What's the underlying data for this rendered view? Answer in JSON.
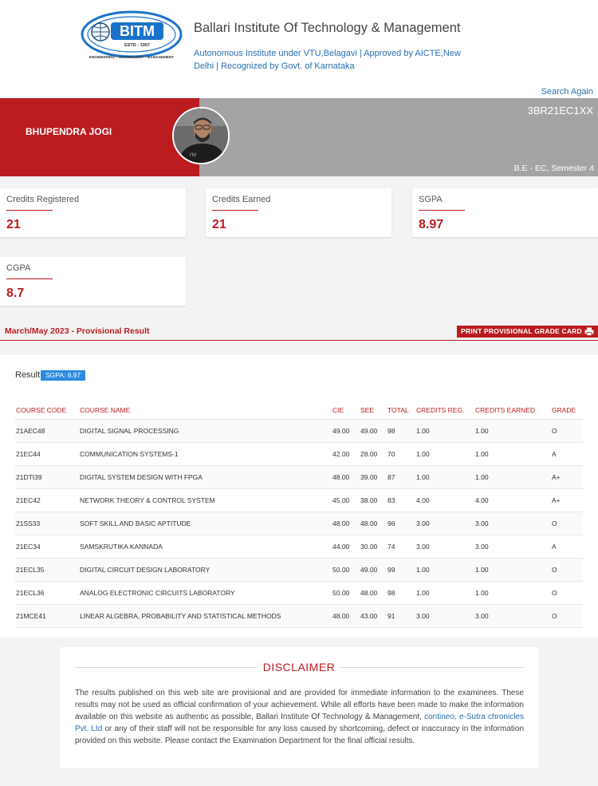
{
  "header": {
    "logo_text": "BITM",
    "logo_estd": "ESTD : 1997",
    "logo_motto": "ENGINEERING • TECHNOLOGY • MANAGEMENT",
    "institute_name": "Ballari Institute Of Technology & Management",
    "institute_sub": "Autonomous Institute under VTU,Belagavi | Approved by AICTE,New Delhi | Recognized by Govt. of Karnataka",
    "search_again": "Search Again"
  },
  "student": {
    "name": "BHUPENDRA JOGI",
    "usn": "3BR21EC1XX",
    "program": "B.E - EC, Semester 4"
  },
  "stats": {
    "credits_registered": {
      "label": "Credits Registered",
      "value": "21"
    },
    "credits_earned": {
      "label": "Credits Earned",
      "value": "21"
    },
    "sgpa": {
      "label": "SGPA",
      "value": "8.97"
    },
    "cgpa": {
      "label": "CGPA",
      "value": "8.7"
    }
  },
  "exam": {
    "title": "March/May 2023 - Provisional Result",
    "print_button": "PRINT PROVISIONAL GRADE CARD"
  },
  "result": {
    "label": "Result",
    "sgpa_badge": "SGPA: 8.97",
    "columns": [
      "COURSE CODE",
      "COURSE NAME",
      "CIE",
      "SEE",
      "TOTAL",
      "CREDITS REG.",
      "CREDITS EARNED",
      "GRADE"
    ],
    "rows": [
      [
        "21AEC48",
        "DIGITAL SIGNAL PROCESSING",
        "49.00",
        "49.00",
        "98",
        "1.00",
        "1.00",
        "O"
      ],
      [
        "21EC44",
        "COMMUNICATION SYSTEMS-1",
        "42.00",
        "28.00",
        "70",
        "1.00",
        "1.00",
        "A"
      ],
      [
        "21DTI39",
        "DIGITAL SYSTEM DESIGN WITH FPGA",
        "48.00",
        "39.00",
        "87",
        "1.00",
        "1.00",
        "A+"
      ],
      [
        "21EC42",
        "NETWORK THEORY & CONTROL SYSTEM",
        "45.00",
        "38.00",
        "83",
        "4.00",
        "4.00",
        "A+"
      ],
      [
        "21SS33",
        "SOFT SKILL AND BASIC APTITUDE",
        "48.00",
        "48.00",
        "96",
        "3.00",
        "3.00",
        "O"
      ],
      [
        "21EC34",
        "SAMSKRUTIKA KANNADA",
        "44.00",
        "30.00",
        "74",
        "3.00",
        "3.00",
        "A"
      ],
      [
        "21ECL35",
        "DIGITAL CIRCUIT DESIGN LABORATORY",
        "50.00",
        "49.00",
        "99",
        "1.00",
        "1.00",
        "O"
      ],
      [
        "21ECL36",
        "ANALOG ELECTRONIC CIRCUITS LABORATORY",
        "50.00",
        "48.00",
        "98",
        "1.00",
        "1.00",
        "O"
      ],
      [
        "21MCE41",
        "LINEAR ALGEBRA, PROBABILITY AND STATISTICAL METHODS",
        "48.00",
        "43.00",
        "91",
        "3.00",
        "3.00",
        "O"
      ]
    ]
  },
  "disclaimer": {
    "title": "DISCLAIMER",
    "text_before": "The results published on this web site are provisional and are provided for immediate information to the examinees. These results may not be used as official confirmation of your achievement. While all efforts have been made to make the information available on this website as authentic as possible, Ballari Institute Of Technology & Management, ",
    "link_text": "contineo, e-Sutra chronicles Pvt. Ltd",
    "text_after": " or any of their staff will not be responsible for any loss caused by shortcoming, defect or inaccuracy in the information provided on this website. Please contact the Examination Department for the final official results."
  },
  "colors": {
    "brand_red": "#bb1c20",
    "banner_grey": "#a4a4a4",
    "link_blue": "#2a6fb0",
    "badge_blue": "#2b8be0"
  }
}
